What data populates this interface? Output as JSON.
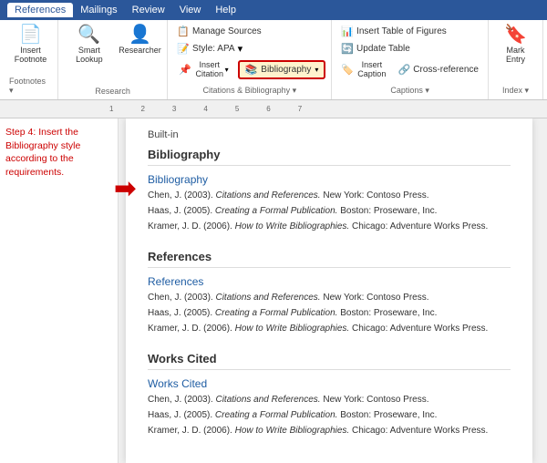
{
  "ribbon": {
    "tabs": [
      "References",
      "Mailings",
      "Review",
      "View",
      "Help"
    ],
    "active_tab": "References"
  },
  "groups": {
    "footnotes": {
      "label": "Footnotes",
      "icon": "📝"
    },
    "research": {
      "label": "Research",
      "smart_lookup": "Smart Lookup",
      "researcher": "Researcher",
      "icons": [
        "🔍",
        "👤"
      ]
    },
    "citations": {
      "label": "Citations & Bibliography",
      "insert_citation": "Insert Citation",
      "style_label": "Style: APA",
      "manage_sources": "Manage Sources",
      "bibliography": "Bibliography",
      "bibliography_icon": "📚"
    },
    "captions": {
      "label": "Captions",
      "insert_caption": "Insert Caption",
      "update_table": "Update Table",
      "cross_reference": "Cross-reference",
      "insert_table_of_figures": "Insert Table of Figures"
    },
    "index": {
      "label": "Index",
      "mark_entry": "Mark Entry"
    }
  },
  "document": {
    "builtin_label": "Built-in",
    "sections": [
      {
        "header": "Bibliography",
        "title": "Bibliography",
        "entries": [
          "Chen, J. (2003). <em>Citations and References.</em> New York: Contoso Press.",
          "Haas, J. (2005). <em>Creating a Formal Publication.</em> Boston: Proseware, Inc.",
          "Kramer, J. D. (2006). <em>How to Write Bibliographies.</em> Chicago: Adventure Works Press."
        ]
      },
      {
        "header": "References",
        "title": "References",
        "entries": [
          "Chen, J. (2003). <em>Citations and References.</em> New York: Contoso Press.",
          "Haas, J. (2005). <em>Creating a Formal Publication.</em> Boston: Proseware, Inc.",
          "Kramer, J. D. (2006). <em>How to Write Bibliographies.</em> Chicago: Adventure Works Press."
        ]
      },
      {
        "header": "Works Cited",
        "title": "Works Cited",
        "entries": [
          "Chen, J. (2003). <em>Citations and References.</em> New York: Contoso Press.",
          "Haas, J. (2005). <em>Creating a Formal Publication.</em> Boston: Proseware, Inc.",
          "Kramer, J. D. (2006). <em>How to Write Bibliographies.</em> Chicago: Adventure Works Press."
        ]
      }
    ]
  },
  "sidebar": {
    "step_text": "Step 4: Insert the Bibliography style according to the requirements."
  }
}
